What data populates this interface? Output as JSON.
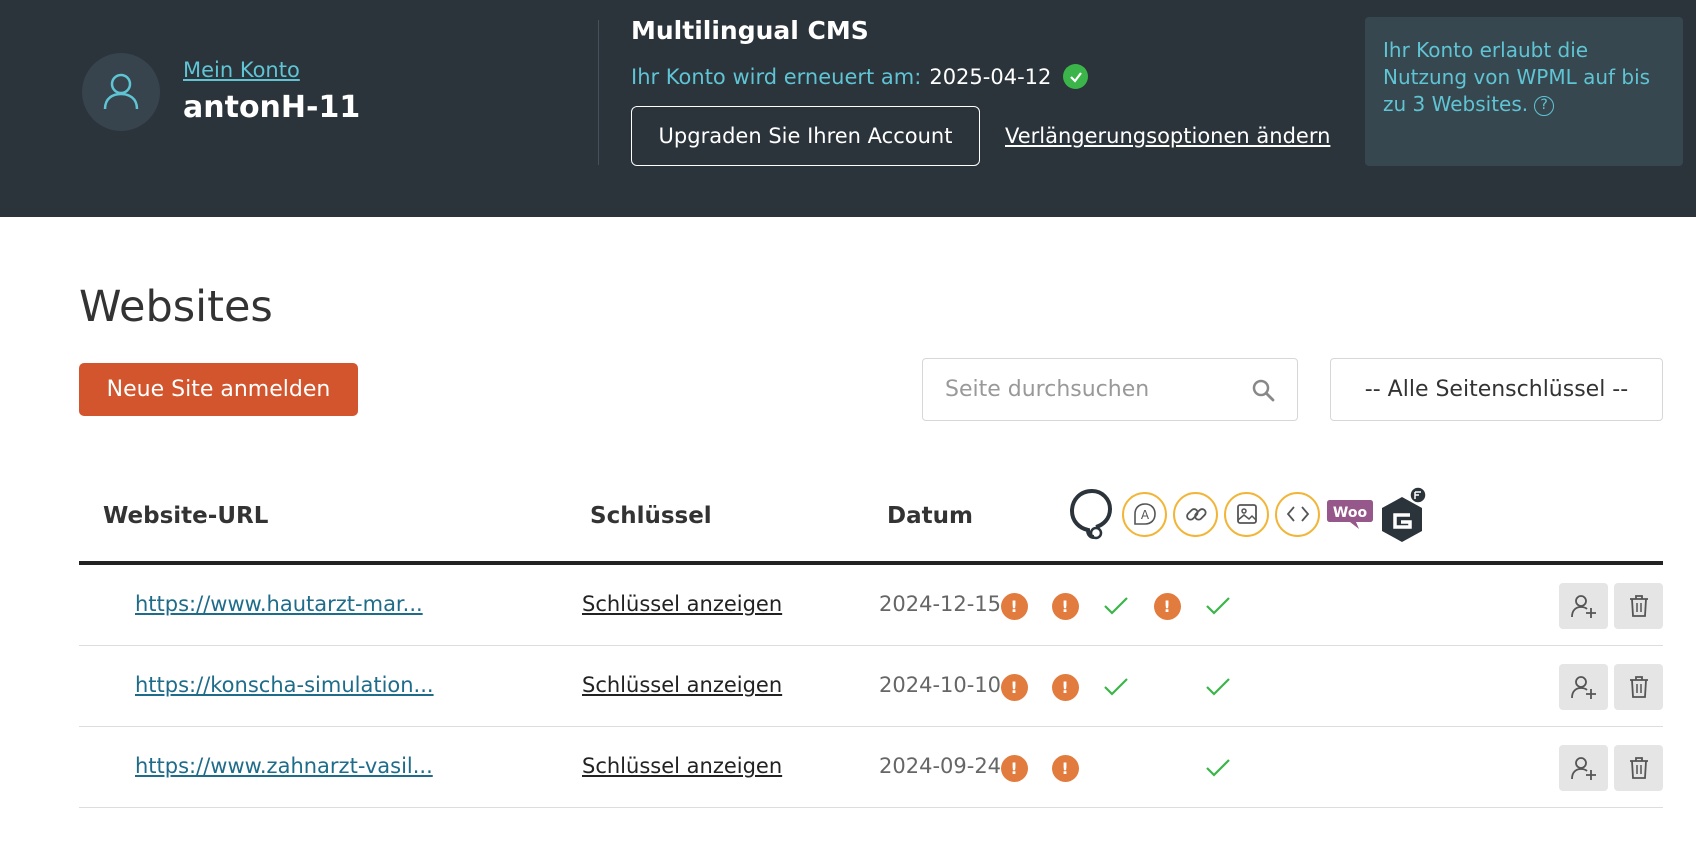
{
  "header": {
    "account_link": "Mein Konto",
    "username": "antonH-11",
    "product_title": "Multilingual CMS",
    "renew_label": "Ihr Konto wird erneuert am:",
    "renew_date": "2025-04-12",
    "upgrade_label": "Upgraden Sie Ihren Account",
    "renew_options_label": "Verlängerungsoptionen ändern",
    "info_text": "Ihr Konto erlaubt die Nutzung von WPML auf bis zu 3 Websites.",
    "info_help_glyph": "?"
  },
  "main": {
    "title": "Websites",
    "new_site_label": "Neue Site anmelden",
    "search_placeholder": "Seite durchsuchen",
    "key_filter_label": "-- Alle Seitenschlüssel --"
  },
  "table": {
    "headers": {
      "url": "Website-URL",
      "key": "Schlüssel",
      "date": "Datum"
    },
    "column_icons": [
      "wpml-logo-icon",
      "string-translation-icon",
      "link-icon",
      "media-icon",
      "code-icon",
      "woocommerce-icon",
      "gravity-forms-icon"
    ],
    "woo_label": "Woo",
    "rows": [
      {
        "url": "https://www.hautarzt-mar...",
        "key_label": "Schlüssel anzeigen",
        "date": "2024-12-15",
        "statuses": [
          "warn",
          "warn",
          "check",
          "warn",
          "check"
        ]
      },
      {
        "url": "https://konscha-simulation...",
        "key_label": "Schlüssel anzeigen",
        "date": "2024-10-10",
        "statuses": [
          "warn",
          "warn",
          "check",
          "none",
          "check"
        ]
      },
      {
        "url": "https://www.zahnarzt-vasil...",
        "key_label": "Schlüssel anzeigen",
        "date": "2024-09-24",
        "statuses": [
          "warn",
          "warn",
          "none",
          "none",
          "check"
        ]
      }
    ],
    "warn_glyph": "!"
  },
  "colors": {
    "header_bg": "#2b333b",
    "accent_teal": "#5fc4d4",
    "primary_orange": "#d3552e",
    "warn_orange": "#e27b3e",
    "check_green": "#3bb54a",
    "icon_ring": "#f2b538",
    "woo_purple": "#96588a"
  }
}
